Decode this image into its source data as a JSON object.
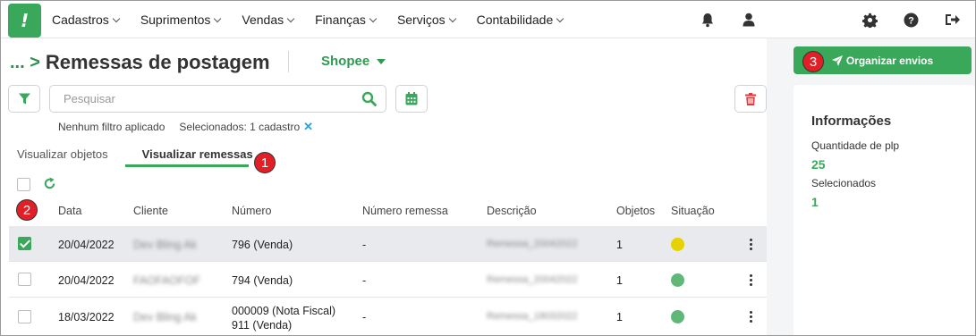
{
  "nav": {
    "logo": "!",
    "menu": [
      "Cadastros",
      "Suprimentos",
      "Vendas",
      "Finanças",
      "Serviços",
      "Contabilidade"
    ]
  },
  "page": {
    "crumb": "...",
    "title": "Remessas de postagem",
    "store": "Shopee"
  },
  "search": {
    "placeholder": "Pesquisar"
  },
  "filters": {
    "none": "Nenhum filtro aplicado",
    "selected": "Selecionados: 1 cadastro"
  },
  "tabs": [
    "Visualizar objetos",
    "Visualizar remessas"
  ],
  "table": {
    "headers": [
      "Data",
      "Cliente",
      "Número",
      "Número remessa",
      "Descrição",
      "Objetos",
      "Situação"
    ],
    "rows": [
      {
        "date": "20/04/2022",
        "client": "Dev Bling Ak",
        "number": "796 (Venda)",
        "number2": "",
        "remessa": "-",
        "desc": "Remessa_20042022",
        "objects": "1",
        "status_color": "#e5d200",
        "checked": true
      },
      {
        "date": "20/04/2022",
        "client": "FAOFAOFOF",
        "number": "794 (Venda)",
        "number2": "",
        "remessa": "-",
        "desc": "Remessa_20042022",
        "objects": "1",
        "status_color": "#5fb878",
        "checked": false
      },
      {
        "date": "18/03/2022",
        "client": "Dev Bling Ak",
        "number": "000009 (Nota Fiscal)",
        "number2": "911 (Venda)",
        "remessa": "-",
        "desc": "Remessa_18032022",
        "objects": "1",
        "status_color": "#5fb878",
        "checked": false
      }
    ]
  },
  "annotations": [
    "1",
    "2",
    "3"
  ],
  "actions": {
    "organize": "Organizar envios"
  },
  "info": {
    "title": "Informações",
    "plp_label": "Quantidade de plp",
    "plp_value": "25",
    "selected_label": "Selecionados",
    "selected_value": "1"
  }
}
